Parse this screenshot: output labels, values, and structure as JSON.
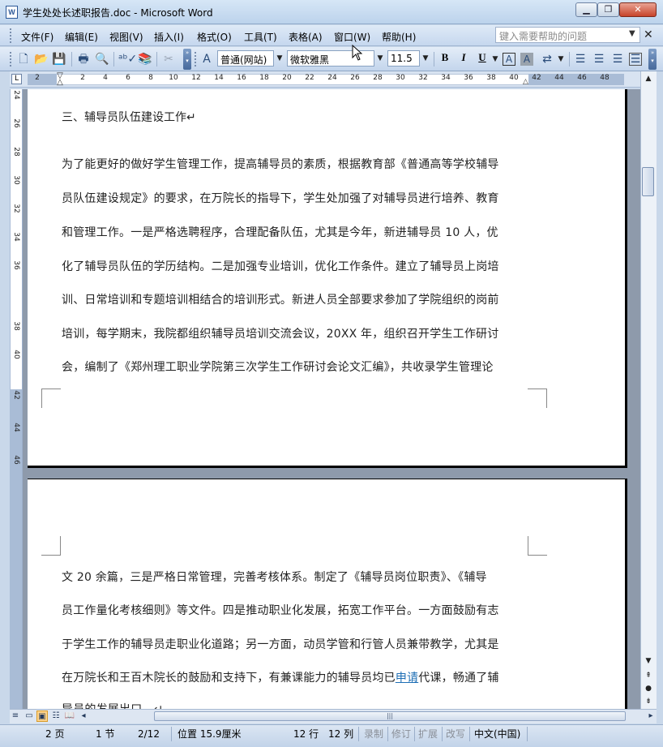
{
  "window": {
    "title": "学生处处长述职报告.doc - Microsoft Word",
    "icon": "word-doc-icon"
  },
  "window_controls": {
    "minimize": "▁",
    "restore": "❐",
    "close": "✕"
  },
  "menu": {
    "items": [
      "文件(F)",
      "编辑(E)",
      "视图(V)",
      "插入(I)",
      "格式(O)",
      "工具(T)",
      "表格(A)",
      "窗口(W)",
      "帮助(H)"
    ],
    "help_placeholder": "键入需要帮助的问题"
  },
  "toolbar": {
    "style": "普通(网站)",
    "font": "微软雅黑",
    "size": "11.5",
    "bold": "B",
    "italic": "I",
    "underline": "U"
  },
  "ruler": {
    "ticks": [
      "2",
      "2",
      "4",
      "6",
      "8",
      "10",
      "12",
      "14",
      "16",
      "18",
      "20",
      "22",
      "24",
      "26",
      "28",
      "30",
      "32",
      "34",
      "36",
      "38",
      "40",
      "42",
      "44",
      "46",
      "48"
    ],
    "vticks": [
      "24",
      "26",
      "28",
      "30",
      "32",
      "34",
      "36",
      "38",
      "40",
      "42",
      "44",
      "46"
    ]
  },
  "document": {
    "page1": {
      "heading": "三、辅导员队伍建设工作↵",
      "lines": [
        "为了能更好的做好学生管理工作，提高辅导员的素质，根据教育部《普通高等学校辅导",
        "员队伍建设规定》的要求，在万院长的指导下，学生处加强了对辅导员进行培养、教育",
        "和管理工作。一是严格选聘程序，合理配备队伍，尤其是今年，新进辅导员 10 人，优",
        "化了辅导员队伍的学历结构。二是加强专业培训，优化工作条件。建立了辅导员上岗培",
        "训、日常培训和专题培训相结合的培训形式。新进人员全部要求参加了学院组织的岗前",
        "培训，每学期末，我院都组织辅导员培训交流会议，20XX 年，组织召开学生工作研讨",
        "会，编制了《郑州理工职业学院第三次学生工作研讨会论文汇编》，共收录学生管理论"
      ]
    },
    "page2": {
      "lines": [
        "文 20 余篇，三是严格日常管理，完善考核体系。制定了《辅导员岗位职责》、《辅导",
        "员工作量化考核细则》等文件。四是推动职业化发展，拓宽工作平台。一方面鼓励有志",
        "于学生工作的辅导员走职业化道路；另一方面，动员学管和行管人员兼带教学，尤其是"
      ],
      "line4_before": "在万院长和王百木院长的鼓励和支持下，有兼课能力的辅导员均已",
      "line4_link": "申请",
      "line4_after": "代课，畅通了辅",
      "line5": "导员的发展出口。↵"
    }
  },
  "status": {
    "page": "2 页",
    "section": "1 节",
    "page_of": "2/12",
    "position": "位置 15.9厘米",
    "line": "12 行",
    "column": "12 列",
    "rec": "录制",
    "trk": "修订",
    "ext": "扩展",
    "ovr": "改写",
    "language": "中文(中国)"
  }
}
